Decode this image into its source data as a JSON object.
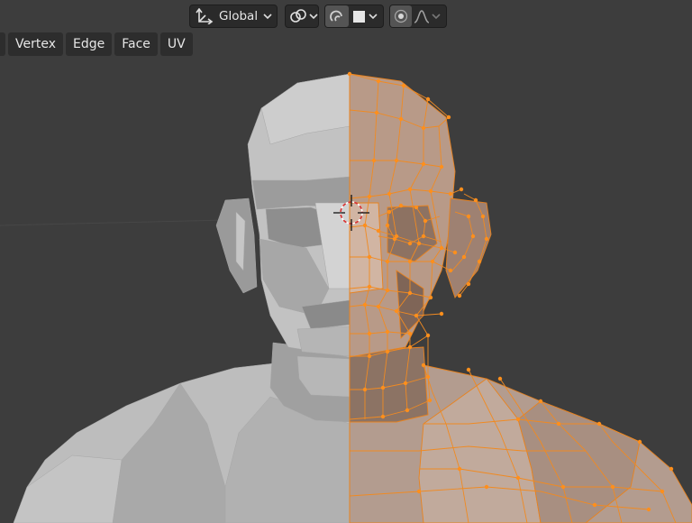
{
  "header": {
    "transform_orientation": {
      "value": "Global",
      "icon": "transform-axes-icon",
      "chevron": "chevron-down-icon"
    },
    "pivot": {
      "icon": "link-icon",
      "chevron": "chevron-down-icon"
    },
    "snap": {
      "icon": "snap-magnet-icon",
      "element_icon": "snap-increment-icon",
      "chevron": "chevron-down-icon"
    },
    "proportional": {
      "icon": "proportional-edit-icon",
      "falloff_icon": "falloff-curve-icon",
      "chevron": "chevron-down-icon"
    }
  },
  "menu": {
    "items": [
      {
        "label": "",
        "name": "menu-select"
      },
      {
        "label": "Vertex",
        "name": "menu-vertex"
      },
      {
        "label": "Edge",
        "name": "menu-edge"
      },
      {
        "label": "Face",
        "name": "menu-face"
      },
      {
        "label": "UV",
        "name": "menu-uv"
      }
    ]
  },
  "viewport": {
    "background": "#3d3d3d",
    "mesh_color": "#b9b9b9",
    "selected_color": "#ff8c1a",
    "object": "human bust mesh, left half selected in edit mode",
    "cursor": "3d-cursor-icon"
  }
}
